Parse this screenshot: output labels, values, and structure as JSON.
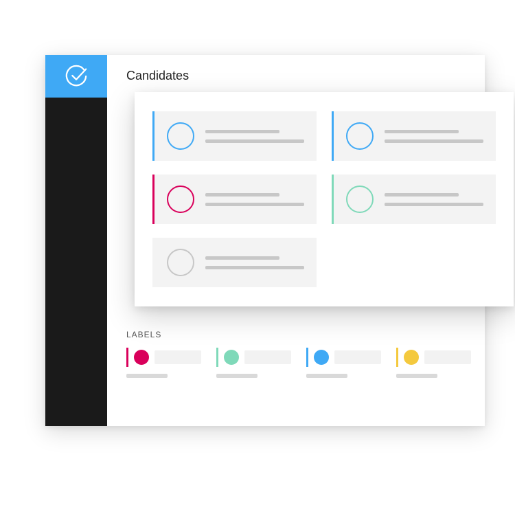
{
  "page": {
    "title": "Candidates",
    "labels_header": "LABELS"
  },
  "colors": {
    "blue": "#3fa9f5",
    "magenta": "#d9005b",
    "teal": "#7fd9b9",
    "yellow": "#f4c93e",
    "gray": "#c7c7c7",
    "card_bg": "#f3f3f3"
  },
  "candidates": [
    {
      "accent": "#3fa9f5",
      "circle": "#3fa9f5"
    },
    {
      "accent": "#3fa9f5",
      "circle": "#3fa9f5"
    },
    {
      "accent": "#d9005b",
      "circle": "#d9005b"
    },
    {
      "accent": "#7fd9b9",
      "circle": "#7fd9b9"
    },
    {
      "accent": null,
      "circle": "#c7c7c7"
    }
  ],
  "labels": [
    {
      "bar": "#d9005b",
      "dot": "#d9005b"
    },
    {
      "bar": "#7fd9b9",
      "dot": "#7fd9b9"
    },
    {
      "bar": "#3fa9f5",
      "dot": "#3fa9f5"
    },
    {
      "bar": "#f4c93e",
      "dot": "#f4c93e"
    }
  ]
}
